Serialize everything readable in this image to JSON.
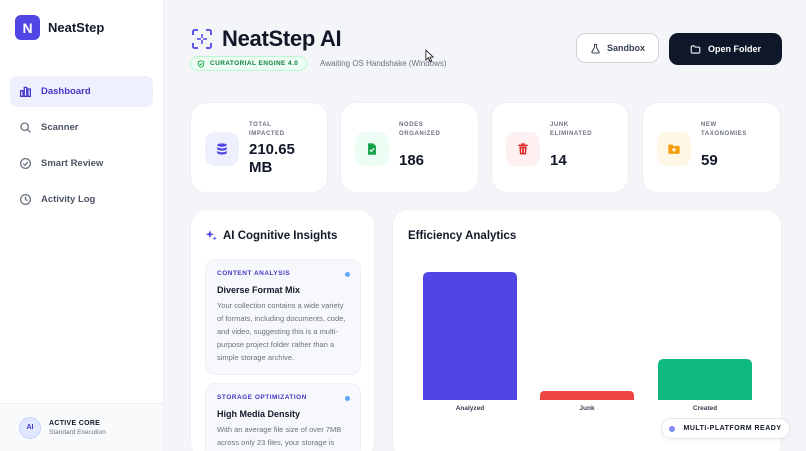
{
  "brand": {
    "logo_letter": "N",
    "name": "NeatStep",
    "color": "#4f46e5"
  },
  "nav": {
    "items": [
      {
        "label": "Dashboard",
        "icon": "bar-chart-icon",
        "active": true
      },
      {
        "label": "Scanner",
        "icon": "search-icon",
        "active": false
      },
      {
        "label": "Smart Review",
        "icon": "check-circle-icon",
        "active": false
      },
      {
        "label": "Activity Log",
        "icon": "clock-icon",
        "active": false
      }
    ]
  },
  "core": {
    "avatar": "AI",
    "title": "ACTIVE CORE",
    "subtitle": "Standard Execution"
  },
  "header": {
    "title": "NeatStep AI",
    "badge": "CURATORIAL ENGINE 4.0",
    "status": "Awaiting OS Handshake (Windows)",
    "sandbox_label": "Sandbox",
    "open_label": "Open Folder"
  },
  "stats": [
    {
      "label_lines": [
        "TOTAL",
        "IMPACTED"
      ],
      "value_lines": [
        "210.65",
        "MB"
      ],
      "icon": "database-icon",
      "icon_color": "#4f46e5",
      "bg": "#eef0fd"
    },
    {
      "label_lines": [
        "NODES",
        "ORGANIZED"
      ],
      "value_lines": [
        "186"
      ],
      "icon": "file-check-icon",
      "icon_color": "#16a34a",
      "bg": "#ecfdf3"
    },
    {
      "label_lines": [
        "JUNK",
        "ELIMINATED"
      ],
      "value_lines": [
        "14"
      ],
      "icon": "trash-icon",
      "icon_color": "#dc2626",
      "bg": "#fef0f0"
    },
    {
      "label_lines": [
        "NEW",
        "TAXONOMIES"
      ],
      "value_lines": [
        "59"
      ],
      "icon": "folder-plus-icon",
      "icon_color": "#d97706",
      "bg": "#fff7e6"
    }
  ],
  "insights": {
    "title": "AI Cognitive Insights",
    "cards": [
      {
        "category": "CONTENT ANALYSIS",
        "heading": "Diverse Format Mix",
        "body": "Your collection contains a wide variety of formats, including documents, code, and video, suggesting this is a multi-purpose project folder rather than a simple storage archive."
      },
      {
        "category": "STORAGE OPTIMIZATION",
        "heading": "High Media Density",
        "body": "With an average file size of over 7MB across only 23 files, your storage is"
      }
    ]
  },
  "analytics": {
    "title": "Efficiency Analytics"
  },
  "chart_data": {
    "type": "bar",
    "categories": [
      "Analyzed",
      "Junk",
      "Created"
    ],
    "values": [
      100,
      7,
      32
    ],
    "colors": [
      "#4f46e5",
      "#ef4444",
      "#10b981"
    ],
    "ylim": [
      0,
      100
    ],
    "grid": false,
    "title": "Efficiency Analytics"
  },
  "footer_pill": "MULTI-PLATFORM READY"
}
